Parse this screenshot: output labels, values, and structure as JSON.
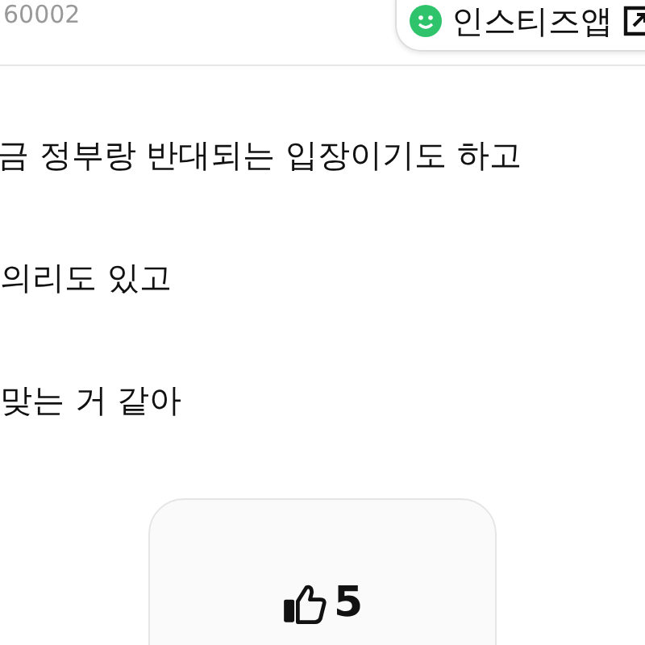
{
  "header": {
    "view_count": "60002",
    "app_badge": {
      "label": "인스티즈앱"
    }
  },
  "post": {
    "lines": [
      "금 정부랑 반대되는 입장이기도 하고",
      "의리도 있고",
      "맞는 거 같아"
    ]
  },
  "like_button": {
    "count": "5"
  }
}
